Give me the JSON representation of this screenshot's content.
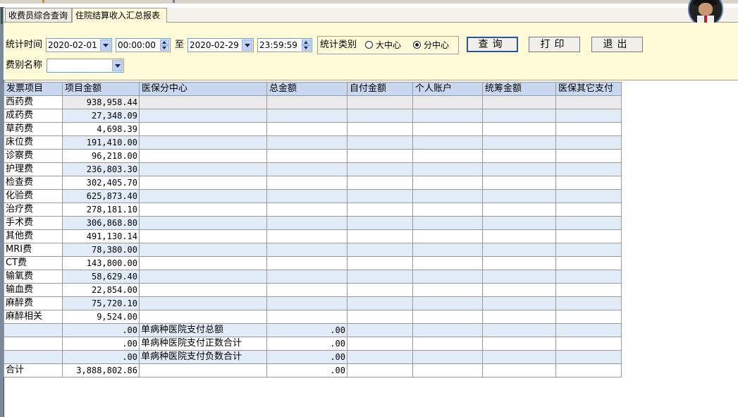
{
  "tabs": [
    {
      "label": "收费员综合查询",
      "active": false
    },
    {
      "label": "住院结算收入汇总报表",
      "active": true
    }
  ],
  "filters": {
    "stat_time_label": "统计时间",
    "start_date": "2020-02-01",
    "start_time": "00:00:00",
    "to_label": "至",
    "end_date": "2020-02-29",
    "end_time": "23:59:59",
    "stat_type_label": "统计类别",
    "type_options": [
      {
        "label": "大中心",
        "checked": false
      },
      {
        "label": "分中心",
        "checked": true
      }
    ],
    "fee_name_label": "费别名称",
    "fee_name_value": ""
  },
  "buttons": {
    "query": "查询",
    "print": "打印",
    "exit": "退出"
  },
  "table": {
    "columns": [
      "发票项目",
      "项目金额",
      "医保分中心",
      "总金额",
      "自付金额",
      "个人账户",
      "统筹金额",
      "医保其它支付"
    ],
    "rows": [
      [
        "西药费",
        "938,958.44",
        "",
        "",
        "",
        "",
        "",
        ""
      ],
      [
        "成药费",
        "27,348.09",
        "",
        "",
        "",
        "",
        "",
        ""
      ],
      [
        "草药费",
        "4,698.39",
        "",
        "",
        "",
        "",
        "",
        ""
      ],
      [
        "床位费",
        "191,410.00",
        "",
        "",
        "",
        "",
        "",
        ""
      ],
      [
        "诊察费",
        "96,218.00",
        "",
        "",
        "",
        "",
        "",
        ""
      ],
      [
        "护理费",
        "236,803.30",
        "",
        "",
        "",
        "",
        "",
        ""
      ],
      [
        "检查费",
        "302,405.70",
        "",
        "",
        "",
        "",
        "",
        ""
      ],
      [
        "化验费",
        "625,873.40",
        "",
        "",
        "",
        "",
        "",
        ""
      ],
      [
        "治疗费",
        "278,181.10",
        "",
        "",
        "",
        "",
        "",
        ""
      ],
      [
        "手术费",
        "306,868.80",
        "",
        "",
        "",
        "",
        "",
        ""
      ],
      [
        "其他费",
        "491,130.14",
        "",
        "",
        "",
        "",
        "",
        ""
      ],
      [
        "MRI费",
        "78,380.00",
        "",
        "",
        "",
        "",
        "",
        ""
      ],
      [
        "CT费",
        "143,800.00",
        "",
        "",
        "",
        "",
        "",
        ""
      ],
      [
        "输氧费",
        "58,629.40",
        "",
        "",
        "",
        "",
        "",
        ""
      ],
      [
        "输血费",
        "22,854.00",
        "",
        "",
        "",
        "",
        "",
        ""
      ],
      [
        "麻醉费",
        "75,720.10",
        "",
        "",
        "",
        "",
        "",
        ""
      ],
      [
        "麻醉相关",
        "9,524.00",
        "",
        "",
        "",
        "",
        "",
        ""
      ],
      [
        "",
        ".00",
        "单病种医院支付总额",
        ".00",
        "",
        "",
        "",
        ""
      ],
      [
        "",
        ".00",
        "单病种医院支付正数合计",
        ".00",
        "",
        "",
        "",
        ""
      ],
      [
        "",
        ".00",
        "单病种医院支付负数合计",
        ".00",
        "",
        "",
        "",
        ""
      ],
      [
        "合计",
        "3,888,802.86",
        "",
        ".00",
        "",
        "",
        "",
        ""
      ]
    ]
  }
}
